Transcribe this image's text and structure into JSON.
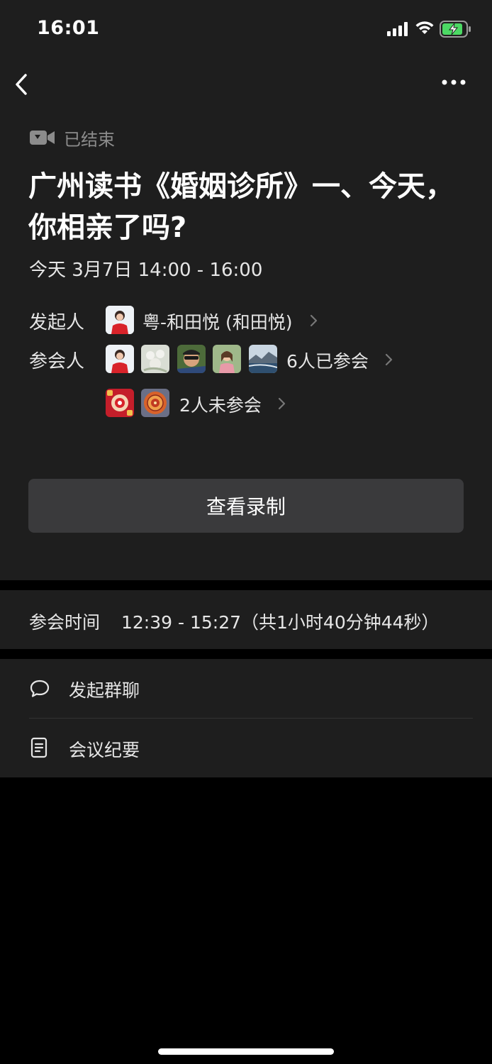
{
  "status_bar": {
    "time": "16:01"
  },
  "icons": {
    "back": "back-icon",
    "more": "more-icon",
    "video": "video-camera-icon",
    "chat": "chat-bubble-icon",
    "notes": "document-icon"
  },
  "meeting": {
    "status": "已结束",
    "title": "广州读书《婚姻诊所》一、今天，你相亲了吗?",
    "time": "今天 3月7日 14:00 - 16:00",
    "host_label": "发起人",
    "host_name": "粤-和田悦 (和田悦)",
    "participants_label": "参会人",
    "attended_count": "6人已参会",
    "absent_count": "2人未参会",
    "record_button": "查看录制"
  },
  "attendance": {
    "label": "参会时间",
    "value": "12:39 - 15:27（共1小时40分钟44秒）"
  },
  "actions": {
    "group_chat": "发起群聊",
    "minutes": "会议纪要"
  },
  "colors": {
    "background": "#000000",
    "panel": "#1e1e1e",
    "button": "#3a3a3c",
    "muted": "#8c8c8c",
    "battery": "#4cd964"
  }
}
